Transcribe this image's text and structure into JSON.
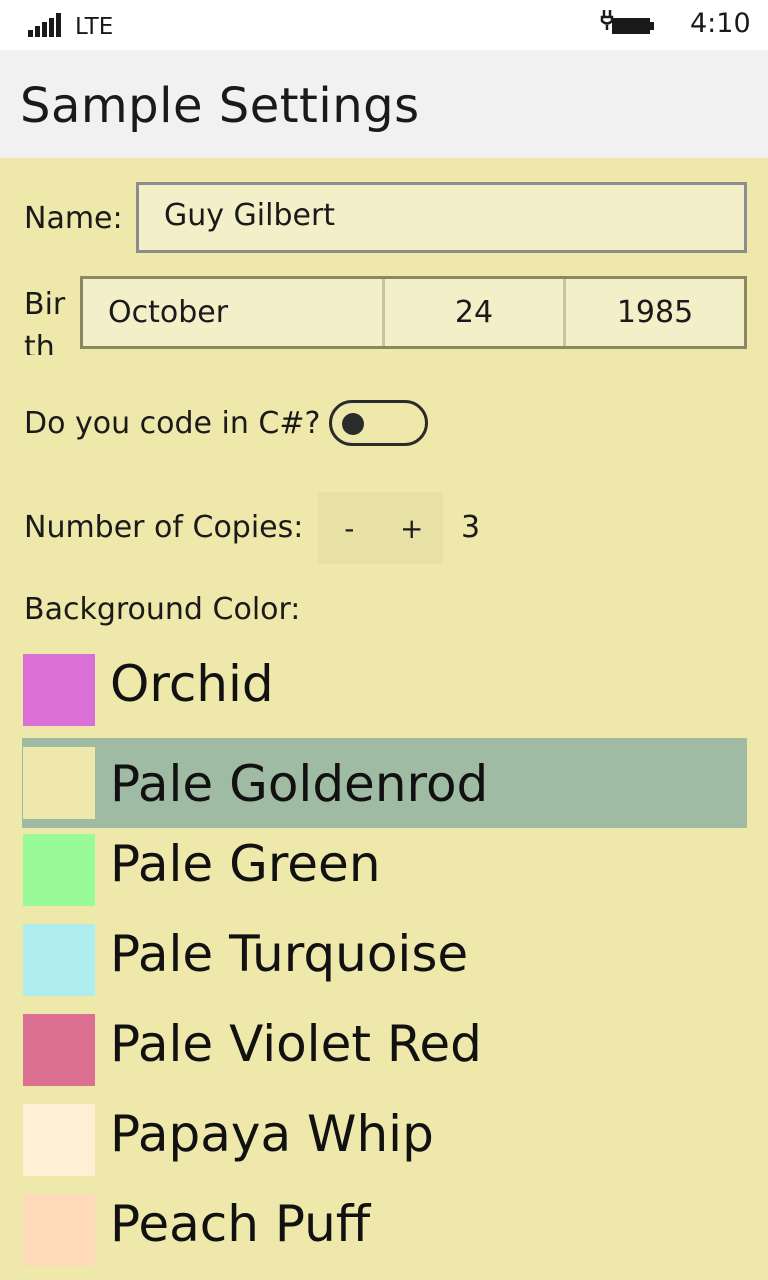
{
  "status_bar": {
    "network": "LTE",
    "time": "4:10",
    "icons": [
      "signal-icon",
      "battery-charging-icon"
    ]
  },
  "header": {
    "title": "Sample Settings"
  },
  "form": {
    "name_label": "Name:",
    "name_value": "Guy Gilbert",
    "birth_label": "Birth",
    "birth_month": "October",
    "birth_day": "24",
    "birth_year": "1985",
    "code_label": "Do you code in C#?",
    "code_toggle_on": false,
    "copies_label": "Number of Copies:",
    "copies_minus": "-",
    "copies_plus": "+",
    "copies_value": "3",
    "bg_label": "Background Color:"
  },
  "colors": {
    "page_background": "#EEE8AA",
    "selected_row": "#A0BBA3",
    "items": [
      {
        "name": "Orchid",
        "swatch": "#DA70D6",
        "selected": false
      },
      {
        "name": "Pale Goldenrod",
        "swatch": "#EEE8AA",
        "selected": true
      },
      {
        "name": "Pale Green",
        "swatch": "#98FB98",
        "selected": false
      },
      {
        "name": "Pale Turquoise",
        "swatch": "#AFEEEE",
        "selected": false
      },
      {
        "name": "Pale Violet Red",
        "swatch": "#DB7093",
        "selected": false
      },
      {
        "name": "Papaya Whip",
        "swatch": "#FFEFD5",
        "selected": false
      },
      {
        "name": "Peach Puff",
        "swatch": "#FFDAB9",
        "selected": false
      }
    ]
  }
}
